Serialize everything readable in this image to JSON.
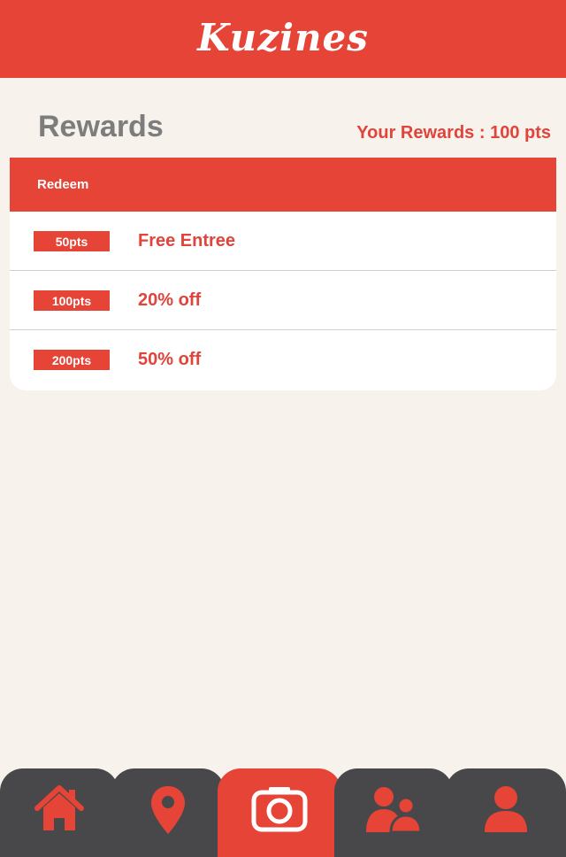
{
  "header": {
    "logo_text": "Kuzines"
  },
  "page": {
    "title": "Rewards",
    "points_summary": "Your Rewards : 100 pts"
  },
  "card": {
    "header_label": "Redeem",
    "rewards": [
      {
        "points": "50pts",
        "name": "Free Entree"
      },
      {
        "points": "100pts",
        "name": "20% off"
      },
      {
        "points": "200pts",
        "name": "50% off"
      }
    ]
  },
  "tabbar": {
    "tabs": [
      {
        "icon": "home-icon"
      },
      {
        "icon": "location-pin-icon"
      },
      {
        "icon": "camera-icon",
        "active": true
      },
      {
        "icon": "friends-icon"
      },
      {
        "icon": "profile-icon"
      }
    ]
  },
  "colors": {
    "brand_red": "#e54437",
    "background": "#f7f2ec",
    "tab_dark": "#48484a",
    "title_gray": "#7d7d7d"
  }
}
